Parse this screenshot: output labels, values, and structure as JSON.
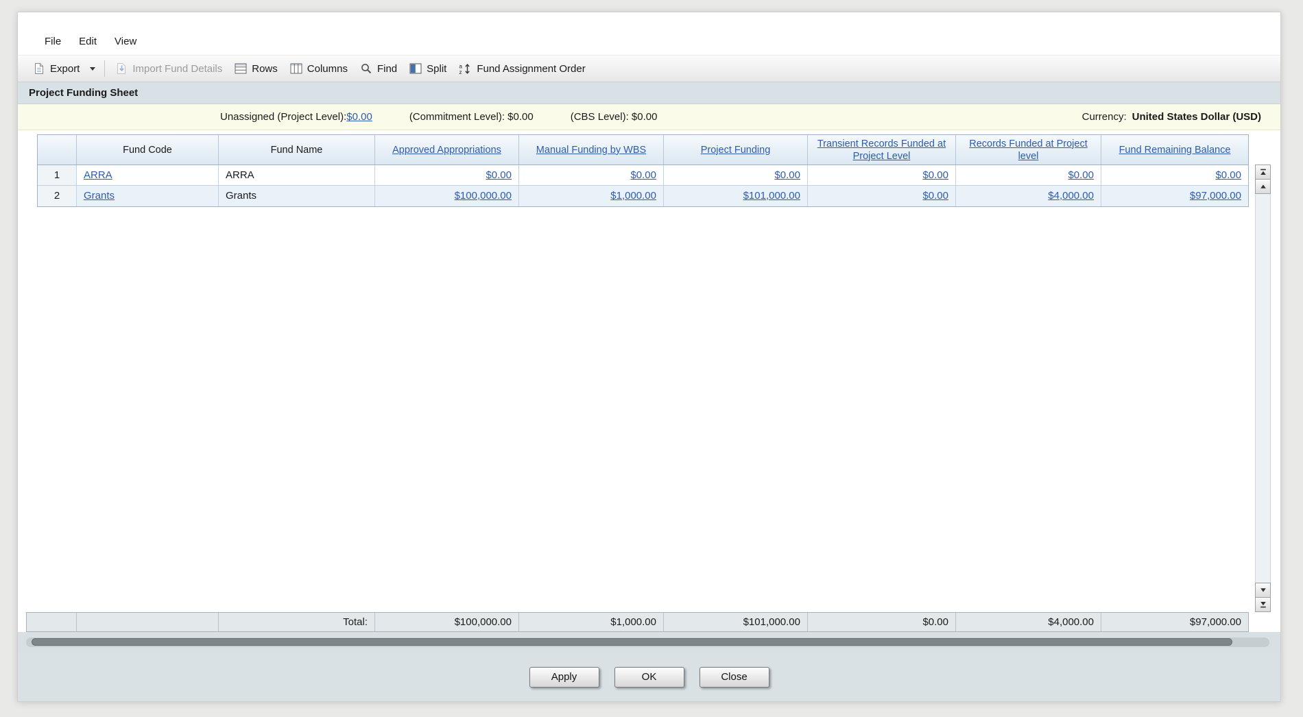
{
  "title": "Project Funding Sheet",
  "menu": {
    "items": [
      "File",
      "Edit",
      "View"
    ]
  },
  "toolbar": {
    "export_label": "Export",
    "import_label": "Import Fund Details",
    "rows_label": "Rows",
    "columns_label": "Columns",
    "find_label": "Find",
    "split_label": "Split",
    "fund_order_label": "Fund Assignment Order"
  },
  "info": {
    "unassigned_label": "Unassigned (Project Level):",
    "unassigned_value": "$0.00",
    "commitment_text": "(Commitment Level): $0.00",
    "cbs_text": "(CBS Level): $0.00",
    "currency_label": "Currency:",
    "currency_value": "United States Dollar (USD)"
  },
  "table": {
    "columns": [
      "Fund Code",
      "Fund Name",
      "Approved Appropriations",
      "Manual Funding by WBS",
      "Project Funding",
      "Transient Records Funded at Project Level",
      "Records Funded at Project level",
      "Fund Remaining Balance"
    ],
    "rows": [
      {
        "num": "1",
        "fund_code": "ARRA",
        "fund_name": "ARRA",
        "values": [
          "$0.00",
          "$0.00",
          "$0.00",
          "$0.00",
          "$0.00",
          "$0.00"
        ]
      },
      {
        "num": "2",
        "fund_code": "Grants",
        "fund_name": "Grants",
        "values": [
          "$100,000.00",
          "$1,000.00",
          "$101,000.00",
          "$0.00",
          "$4,000.00",
          "$97,000.00"
        ]
      }
    ],
    "total_label": "Total:",
    "totals": [
      "$100,000.00",
      "$1,000.00",
      "$101,000.00",
      "$0.00",
      "$4,000.00",
      "$97,000.00"
    ]
  },
  "footer": {
    "buttons": [
      "Apply",
      "OK",
      "Close"
    ]
  },
  "icons": {
    "export": "document-page",
    "export_dropdown": "caret-down",
    "import": "document-page-down-arrow",
    "rows": "rows-grid",
    "columns": "columns-grid",
    "find": "magnifier",
    "split": "split-pane",
    "fund_order": "sort-a-z-updown",
    "scroll_to_top": "triangle-up-with-bar",
    "scroll_up": "triangle-up",
    "scroll_down": "triangle-down",
    "scroll_to_bottom": "triangle-down-with-bar"
  },
  "colors": {
    "link_blue": "#2e5cad",
    "title_bar_bg": "#d8e1e5",
    "info_bar_bg": "#fbfbe9",
    "table_header_bg": "#e3edf6",
    "total_row_bg": "#e3e9eb",
    "disabled_text": "#9b9b9b"
  }
}
